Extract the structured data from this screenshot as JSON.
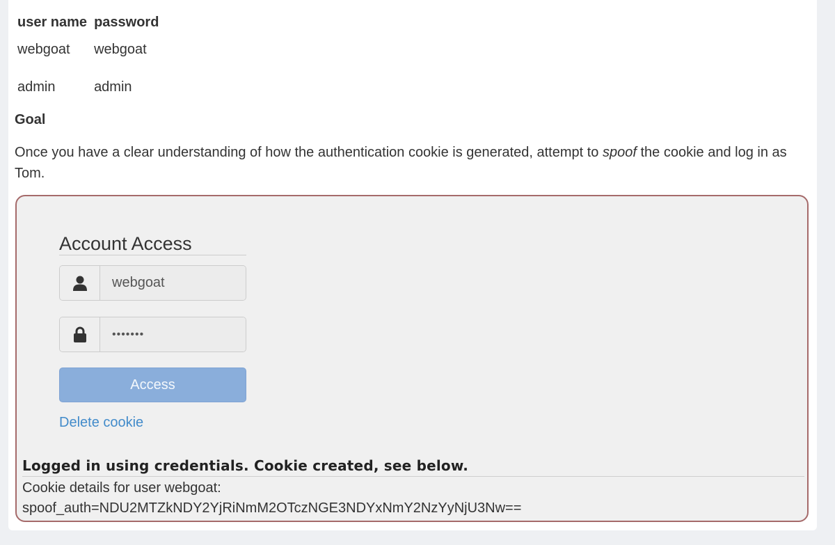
{
  "credentials": {
    "headers": [
      "user name",
      "password"
    ],
    "rows": [
      [
        "webgoat",
        "webgoat"
      ],
      [
        "admin",
        "admin"
      ]
    ]
  },
  "goal": {
    "heading": "Goal",
    "text_before": "Once you have a clear understanding of how the authentication cookie is generated, attempt to ",
    "emphasis": "spoof",
    "text_after": " the cookie and log in as Tom."
  },
  "form": {
    "title": "Account Access",
    "username_value": "webgoat",
    "password_value": "•••••••",
    "user_icon": "user-icon",
    "lock_icon": "lock-icon",
    "submit_label": "Access",
    "delete_link": "Delete cookie"
  },
  "result": {
    "feedback": "Logged in using credentials. Cookie created, see below.",
    "output_line1": "Cookie details for user webgoat:",
    "output_line2": "spoof_auth=NDU2MTZkNDY2YjRiNmM2OTczNGE3NDYxNmY2NzYyNjU3Nw=="
  },
  "colors": {
    "button_bg": "#8aaedb",
    "box_border": "#a56a6a",
    "link": "#428bca"
  }
}
